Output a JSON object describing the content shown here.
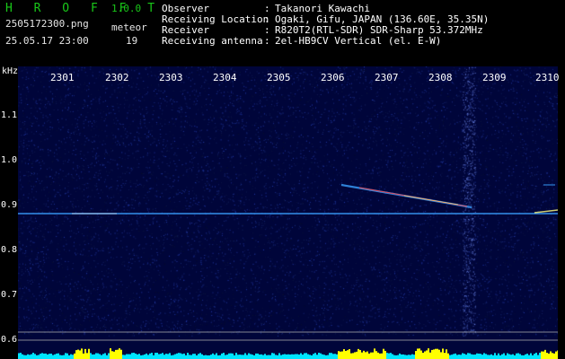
{
  "header": {
    "app_title": "H R O F F T",
    "app_version": "1.0.0",
    "file_name": "2505172300.png",
    "date_time": "25.05.17 23:00",
    "meteor_label": "meteor",
    "meteor_count": "19",
    "info": [
      {
        "key": "Observer",
        "sep": ":",
        "value": "Takanori Kawachi"
      },
      {
        "key": "Receiving Location",
        "sep": ":",
        "value": "Ogaki, Gifu, JAPAN (136.60E, 35.35N)"
      },
      {
        "key": "Receiver",
        "sep": ":",
        "value": "R820T2(RTL-SDR) SDR-Sharp 53.372MHz"
      },
      {
        "key": "Receiving antenna",
        "sep": ":",
        "value": "2el-HB9CV Vertical (el. E-W)"
      }
    ]
  },
  "chart_data": {
    "type": "heatmap",
    "ylabel": "kHz",
    "x_ticks": [
      "2301",
      "2302",
      "2303",
      "2304",
      "2305",
      "2306",
      "2307",
      "2308",
      "2309",
      "2310"
    ],
    "y_ticks": [
      "1.1",
      "1.0",
      "0.9",
      "0.8",
      "0.7",
      "0.6"
    ],
    "colors": {
      "background": "#00053a",
      "signal": "#3aa0ff",
      "meteor": "#ff4040",
      "bar": "#00e5ff",
      "bar_peak": "#ffff00"
    }
  }
}
